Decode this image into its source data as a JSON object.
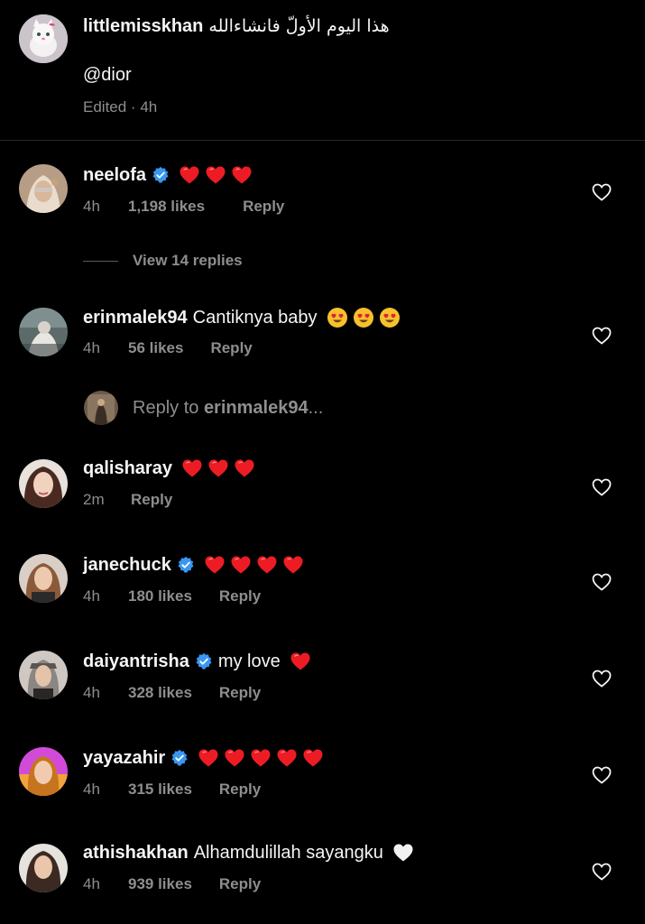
{
  "post_caption": {
    "username": "littlemisskhan",
    "text_rtl": "هذا اليوم الأولّ فانشاءالله",
    "mention": "@dior",
    "edited_label": "Edited",
    "time": "4h"
  },
  "comments": [
    {
      "username": "neelofa",
      "verified": true,
      "text": "",
      "emoji": [
        "red-heart",
        "red-heart",
        "red-heart"
      ],
      "time": "4h",
      "likes": "1,198 likes",
      "reply": "Reply"
    },
    {
      "username": "erinmalek94",
      "verified": false,
      "text": "Cantiknya baby",
      "emoji": [
        "heart-eyes",
        "heart-eyes",
        "heart-eyes"
      ],
      "time": "4h",
      "likes": "56 likes",
      "reply": "Reply"
    },
    {
      "username": "qalisharay",
      "verified": false,
      "text": "",
      "emoji": [
        "red-heart",
        "red-heart",
        "red-heart"
      ],
      "time": "2m",
      "likes": "",
      "reply": "Reply"
    },
    {
      "username": "janechuck",
      "verified": true,
      "text": "",
      "emoji": [
        "red-heart",
        "red-heart",
        "red-heart",
        "red-heart"
      ],
      "time": "4h",
      "likes": "180 likes",
      "reply": "Reply"
    },
    {
      "username": "daiyantrisha",
      "verified": true,
      "text": "my love",
      "emoji": [
        "red-heart"
      ],
      "time": "4h",
      "likes": "328 likes",
      "reply": "Reply"
    },
    {
      "username": "yayazahir",
      "verified": true,
      "text": "",
      "emoji": [
        "red-heart",
        "red-heart",
        "red-heart",
        "red-heart",
        "red-heart"
      ],
      "time": "4h",
      "likes": "315 likes",
      "reply": "Reply"
    },
    {
      "username": "athishakhan",
      "verified": false,
      "text": "Alhamdulillah sayangku",
      "emoji": [
        "white-heart"
      ],
      "time": "4h",
      "likes": "939 likes",
      "reply": "Reply"
    }
  ],
  "view_replies": "View 14 replies",
  "reply_to": {
    "prefix": "Reply to ",
    "username": "erinmalek94",
    "suffix": "..."
  },
  "colors": {
    "background": "#000000",
    "text": "#f5f5f5",
    "muted": "#8e8e8e",
    "verified": "#3897f0",
    "heart_red": "#ed1c24"
  }
}
